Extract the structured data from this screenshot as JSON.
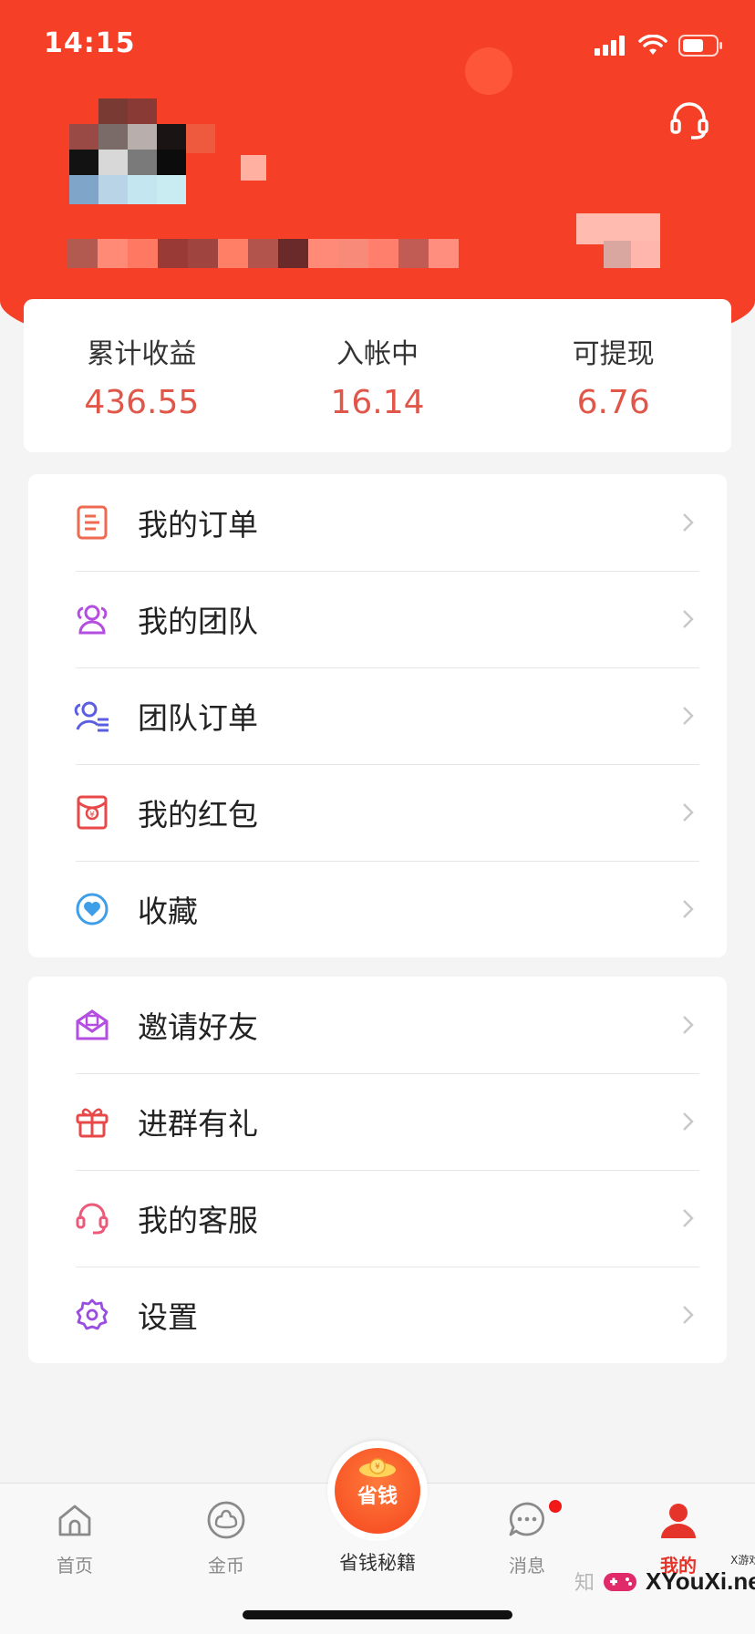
{
  "status_bar": {
    "time": "14:15"
  },
  "stats": [
    {
      "label": "累计收益",
      "value": "436.55"
    },
    {
      "label": "入帐中",
      "value": "16.14"
    },
    {
      "label": "可提现",
      "value": "6.76"
    }
  ],
  "menu_group_1": [
    {
      "label": "我的订单",
      "icon": "order-icon"
    },
    {
      "label": "我的团队",
      "icon": "team-icon"
    },
    {
      "label": "团队订单",
      "icon": "team-order-icon"
    },
    {
      "label": "我的红包",
      "icon": "red-envelope-icon"
    },
    {
      "label": "收藏",
      "icon": "favorite-icon"
    }
  ],
  "menu_group_2": [
    {
      "label": "邀请好友",
      "icon": "invite-icon"
    },
    {
      "label": "进群有礼",
      "icon": "gift-icon"
    },
    {
      "label": "我的客服",
      "icon": "headset-icon"
    },
    {
      "label": "设置",
      "icon": "settings-icon"
    }
  ],
  "tab_bar": {
    "tabs": [
      {
        "label": "首页",
        "icon": "home-icon"
      },
      {
        "label": "金币",
        "icon": "coin-icon"
      },
      {
        "label": "省钱秘籍",
        "badge_text": "省钱",
        "icon": "money-bag-icon"
      },
      {
        "label": "消息",
        "icon": "message-icon"
      },
      {
        "label": "我的",
        "icon": "profile-icon"
      }
    ],
    "active_tab": "我的"
  },
  "watermark": {
    "zhihu": "知",
    "site": "XYouXi.net",
    "small": "X游戏"
  },
  "colors": {
    "header": "#f63f27",
    "stat_value": "#e0574a",
    "active_tab": "#e5342a",
    "notification_dot": "#f21818"
  }
}
